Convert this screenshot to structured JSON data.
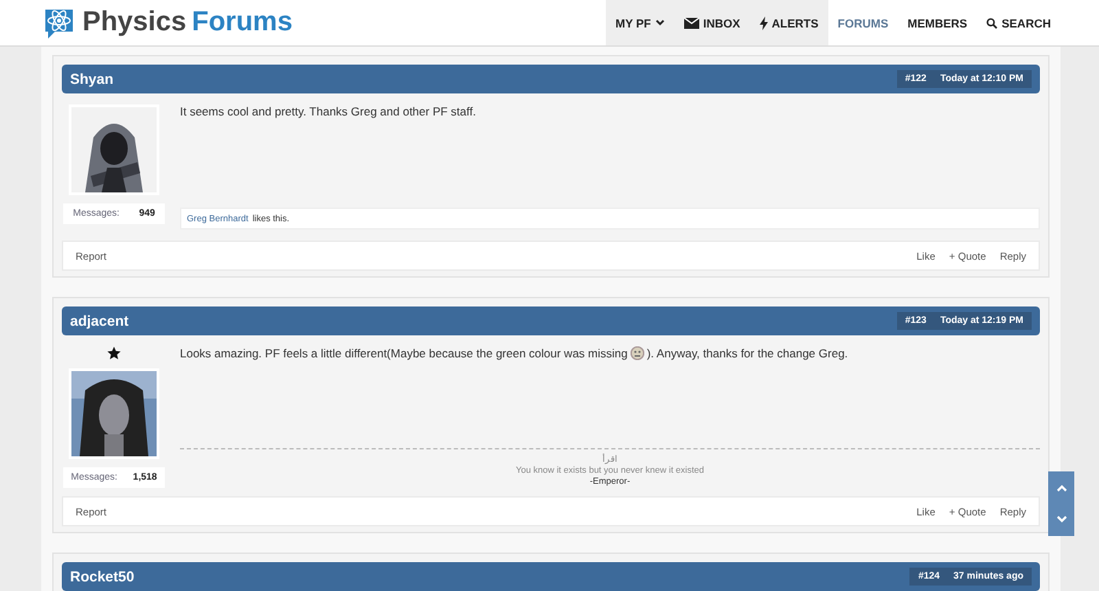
{
  "header": {
    "logo": {
      "first": "Physics",
      "second": "Forums"
    },
    "nav": [
      {
        "label": "MY PF",
        "kind": "caret",
        "selected": false,
        "shaded": true
      },
      {
        "label": "INBOX",
        "kind": "mail",
        "selected": false,
        "shaded": true
      },
      {
        "label": "ALERTS",
        "kind": "bolt",
        "selected": false,
        "shaded": true
      },
      {
        "label": "FORUMS",
        "kind": "plain",
        "selected": true,
        "shaded": false
      },
      {
        "label": "MEMBERS",
        "kind": "plain",
        "selected": false,
        "shaded": false
      },
      {
        "label": "SEARCH",
        "kind": "search",
        "selected": false,
        "shaded": false
      }
    ]
  },
  "posts": [
    {
      "kind": "full",
      "author": "Shyan",
      "number": "#122",
      "time": "Today at 12:10 PM",
      "rank_star": false,
      "messages_label": "Messages:",
      "messages": "949",
      "message": "It seems cool and pretty. Thanks Greg and other PF staff.",
      "emoji": false,
      "likes": {
        "user": "Greg Bernhardt",
        "text": "likes this."
      },
      "actions": {
        "report": "Report",
        "like": "Like",
        "quote": "+ Quote",
        "reply": "Reply"
      }
    },
    {
      "kind": "full",
      "author": "adjacent",
      "number": "#123",
      "time": "Today at 12:19 PM",
      "rank_star": true,
      "messages_label": "Messages:",
      "messages": "1,518",
      "message": "Looks amazing. PF feels a little different(Maybe because the green colour was missing",
      "message_after": "). Anyway, thanks for the change Greg.",
      "emoji": true,
      "signature": [
        {
          "text": "اقرأ",
          "dark": false
        },
        {
          "text": "You know it exists but you never knew it existed",
          "dark": false
        },
        {
          "text": "-Emperor-",
          "dark": true
        }
      ],
      "actions": {
        "report": "Report",
        "like": "Like",
        "quote": "+ Quote",
        "reply": "Reply"
      }
    },
    {
      "kind": "header",
      "author": "Rocket50",
      "number": "#124",
      "time": "37 minutes ago"
    }
  ]
}
